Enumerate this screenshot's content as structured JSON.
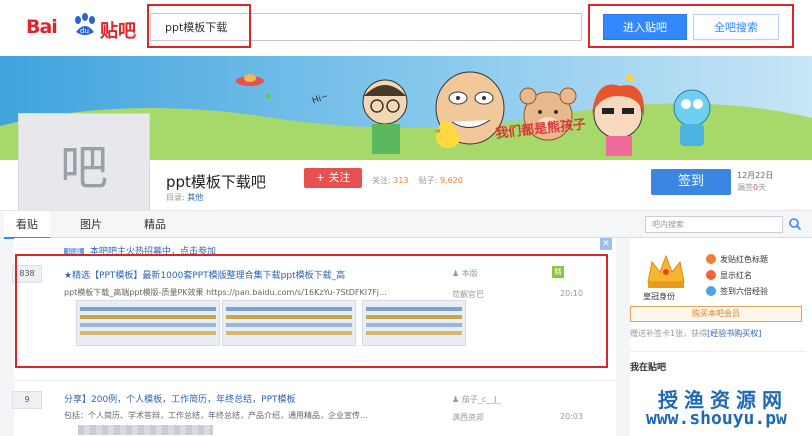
{
  "header": {
    "logo_text_left": "Bai",
    "logo_paw_text": "du",
    "logo_text_right": "贴吧",
    "search_value": "ppt模板下载",
    "enter_button": "进入贴吧",
    "all_search_button": "全吧搜索"
  },
  "banner": {
    "slogan": "我们都是熊孩子",
    "hi_text": "Hi~"
  },
  "forum": {
    "avatar_char": "吧",
    "name": "ppt模板下载吧",
    "follow_label": "+ 关注",
    "followers_label": "关注:",
    "followers_count": "313",
    "posts_label": "贴子:",
    "posts_count": "9,620",
    "category_label": "目录:",
    "category_value": "其他",
    "signin_button": "签到",
    "sign_date": "12月22日",
    "sign_missed_prefix": "漏签",
    "sign_missed_count": "0",
    "sign_missed_suffix": "天"
  },
  "tabs": [
    {
      "label": "看贴"
    },
    {
      "label": "图片"
    },
    {
      "label": "精品"
    }
  ],
  "inner_search_placeholder": "吧内搜索",
  "notice": {
    "tag": "招募",
    "text": "本吧吧主火热招募中，点击参加"
  },
  "threads": [
    {
      "reply_count": "838",
      "title": "★精选【PPT模板】最新1000套PPT模版整理合集下载ppt模板下载_高",
      "excerpt": "ppt模板下载_高端ppt模版-质量PK效果 https://pan.baidu.com/s/16KzYu-7StDFKI7Fj...",
      "author": "本版",
      "last_user": "苟靓官巴",
      "time": "20:10"
    },
    {
      "reply_count": "9",
      "title": "分享】200例，个人模板，工作简历，年终总结，PPT模板",
      "excerpt": "包括：个人简历、学术答辩，工作总结，年终总结，产品介绍，通用精品，企业宣传...",
      "author": "茄子_c__J_",
      "last_user": "满西资邦",
      "time": "20:03"
    }
  ],
  "sidebar": {
    "vip_label": "皇冠身份",
    "perks": [
      "发贴红色标题",
      "显示红名",
      "签到六倍经验"
    ],
    "vip_button": "购买本吧会员",
    "vip_note_prefix": "赠送补签卡1张，获得",
    "vip_note_link": "[经验书购买权]",
    "my_forums": "我在贴吧"
  },
  "watermark": {
    "cn": "授渔资源网",
    "url": "www.shouyu.pw"
  },
  "colors": {
    "brand_red": "#e1242b",
    "primary_blue": "#3388ff",
    "link_blue": "#2d64b3",
    "annotation_red": "#d9262b",
    "follow_red": "#e75050"
  }
}
